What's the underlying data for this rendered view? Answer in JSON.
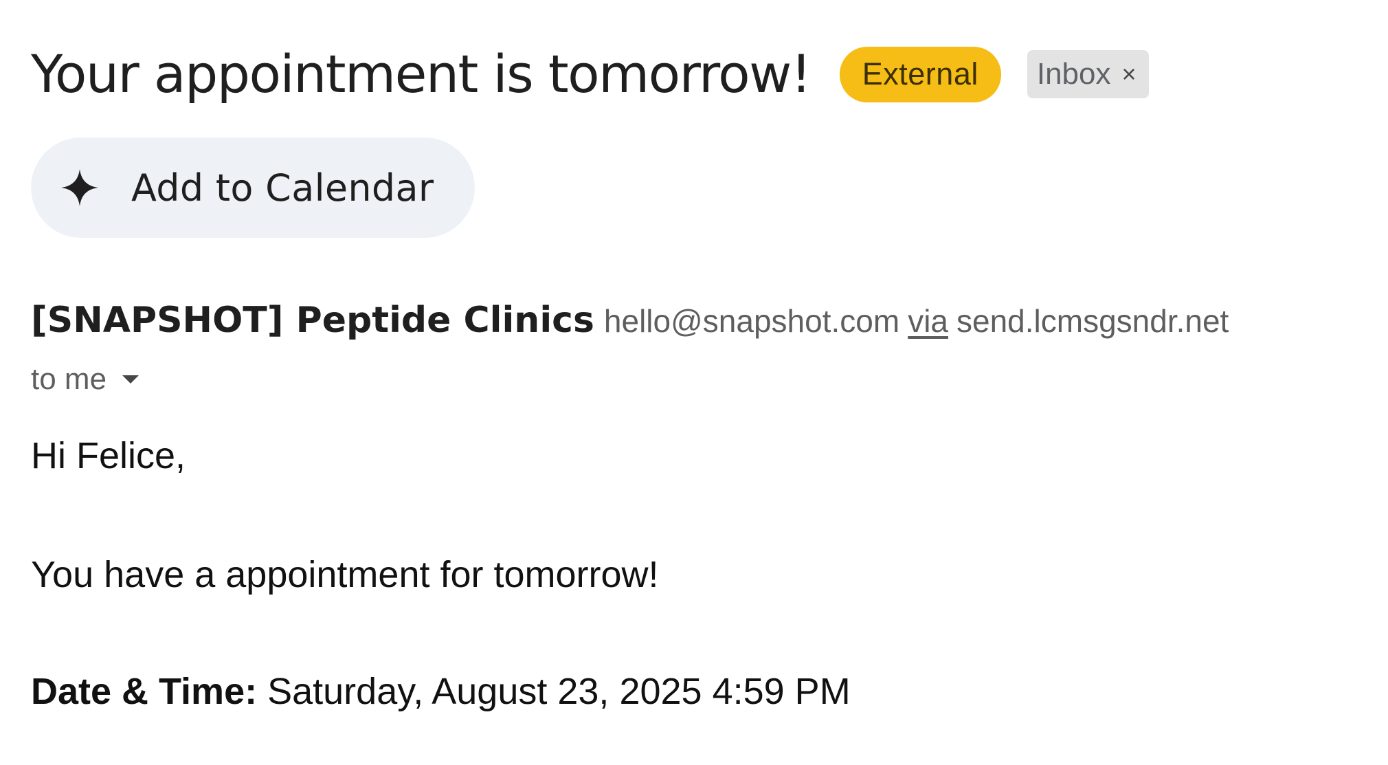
{
  "email": {
    "subject": "Your appointment is tomorrow!",
    "labels": {
      "external": "External",
      "inbox": "Inbox",
      "inbox_remove_glyph": "×"
    },
    "smart_chip": {
      "label": "Add to Calendar",
      "icon": "sparkle-icon"
    },
    "sender": {
      "name": "[SNAPSHOT] Peptide Clinics",
      "email": "hello@snapshot.com",
      "via_label": "via",
      "via_domain": "send.lcmsgsndr.net"
    },
    "recipient": {
      "label": "to me",
      "icon": "caret-down-icon"
    },
    "body": {
      "greeting": "Hi Felice,",
      "message": "You have a appointment for tomorrow!",
      "datetime_label": "Date & Time:",
      "datetime_value": " Saturday, August 23, 2025 4:59 PM"
    }
  },
  "colors": {
    "external_badge": "#f6bd16",
    "inbox_badge": "#e3e3e3",
    "chip_background": "#eef2f7",
    "text_primary": "#1f1f1f",
    "text_secondary": "#5e5e5e"
  }
}
